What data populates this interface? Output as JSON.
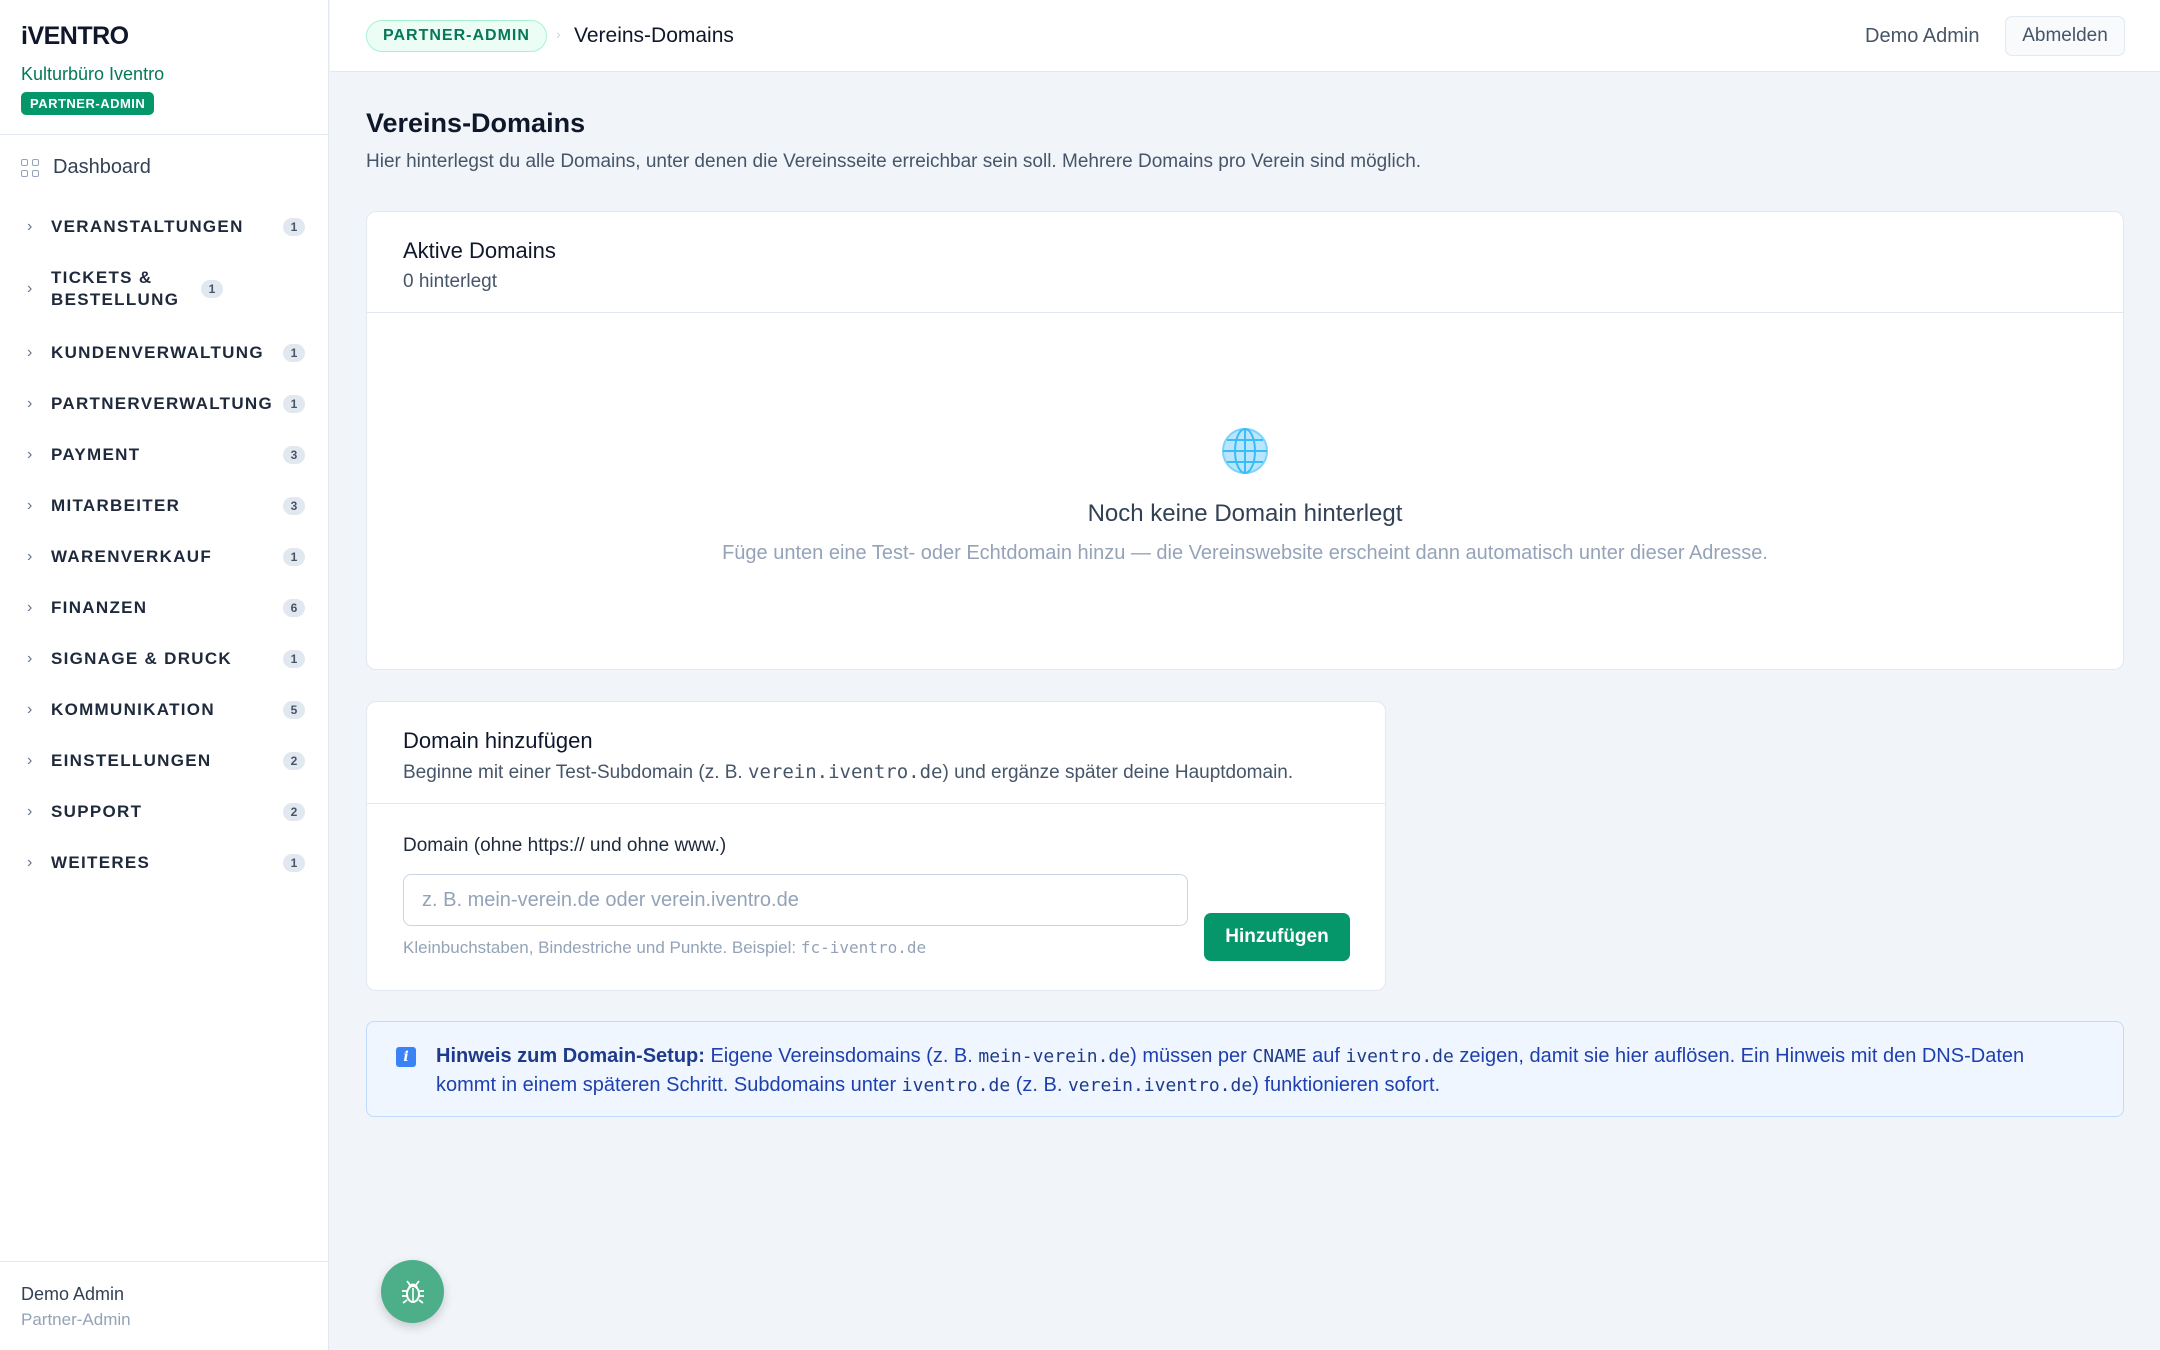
{
  "brand": {
    "logo": "iVENTRO",
    "org": "Kulturbüro Iventro",
    "role_badge": "PARTNER-ADMIN"
  },
  "sidebar": {
    "dashboard_label": "Dashboard",
    "items": [
      {
        "label": "VERANSTALTUNGEN",
        "count": "1"
      },
      {
        "label": "TICKETS & BESTELLUNG",
        "count": "1"
      },
      {
        "label": "KUNDENVERWALTUNG",
        "count": "1"
      },
      {
        "label": "PARTNERVERWALTUNG",
        "count": "1"
      },
      {
        "label": "PAYMENT",
        "count": "3"
      },
      {
        "label": "MITARBEITER",
        "count": "3"
      },
      {
        "label": "WARENVERKAUF",
        "count": "1"
      },
      {
        "label": "FINANZEN",
        "count": "6"
      },
      {
        "label": "SIGNAGE & DRUCK",
        "count": "1"
      },
      {
        "label": "KOMMUNIKATION",
        "count": "5"
      },
      {
        "label": "EINSTELLUNGEN",
        "count": "2"
      },
      {
        "label": "SUPPORT",
        "count": "2"
      },
      {
        "label": "WEITERES",
        "count": "1"
      }
    ],
    "footer": {
      "name": "Demo Admin",
      "role": "Partner-Admin"
    }
  },
  "topbar": {
    "badge": "PARTNER-ADMIN",
    "separator": "›",
    "title": "Vereins-Domains",
    "user": "Demo Admin",
    "logout_label": "Abmelden"
  },
  "page": {
    "title": "Vereins-Domains",
    "description": "Hier hinterlegst du alle Domains, unter denen die Vereinsseite erreichbar sein soll. Mehrere Domains pro Verein sind möglich."
  },
  "domains_card": {
    "title": "Aktive Domains",
    "subtitle": "0 hinterlegt",
    "empty_title": "Noch keine Domain hinterlegt",
    "empty_desc": "Füge unten eine Test- oder Echtdomain hinzu — die Vereinswebsite erscheint dann automatisch unter dieser Adresse."
  },
  "add_card": {
    "title": "Domain hinzufügen",
    "subtitle_pre": "Beginne mit einer Test-Subdomain (z. B. ",
    "subtitle_code": "verein.iventro.de",
    "subtitle_post": ") und ergänze später deine Hauptdomain.",
    "field_label": "Domain (ohne https:// und ohne www.)",
    "field_value": "",
    "field_placeholder": "z. B. mein-verein.de oder verein.iventro.de",
    "help_pre": "Kleinbuchstaben, Bindestriche und Punkte. Beispiel: ",
    "help_code": "fc-iventro.de",
    "button_label": "Hinzufügen"
  },
  "notice": {
    "heading": "Hinweis zum Domain-Setup:",
    "t1": " Eigene Vereinsdomains (z. B. ",
    "c1": "mein-verein.de",
    "t2": ") müssen per ",
    "c2": "CNAME",
    "t3": " auf ",
    "c3": "iventro.de",
    "t4": " zeigen, damit sie hier auflösen. Ein Hinweis mit den DNS-Daten kommt in einem späteren Schritt. Subdomains unter ",
    "c4": "iventro.de",
    "t5": " (z. B. ",
    "c5": "verein.iventro.de",
    "t6": ") funktionieren sofort."
  },
  "colors": {
    "accent": "#059669",
    "accent_dark": "#047857",
    "info": "#1e40af",
    "background": "#f1f5f9"
  },
  "icons": {
    "dashboard": "grid-icon",
    "nav": "chevron-right-icon",
    "empty": "globe-icon",
    "notice": "info-icon",
    "fab": "bug-icon"
  }
}
